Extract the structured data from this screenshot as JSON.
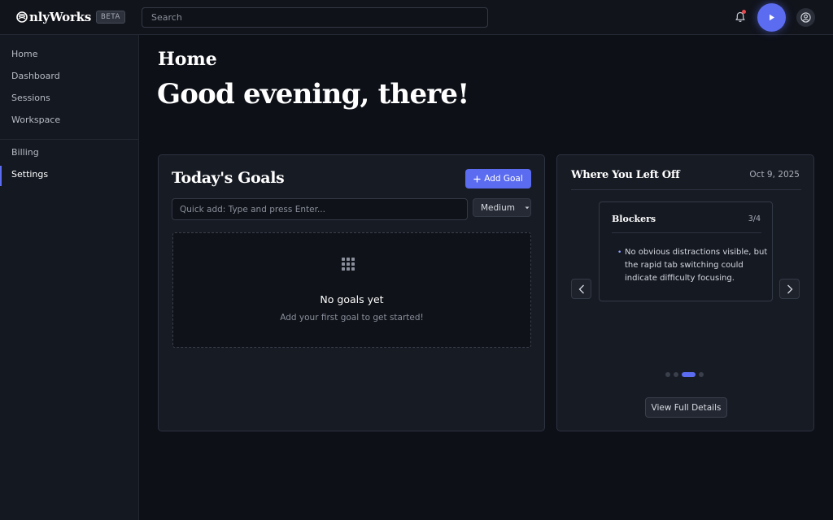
{
  "app": {
    "logo_text": "nlyWorks",
    "beta_badge": "BETA"
  },
  "search": {
    "placeholder": "Search",
    "value": ""
  },
  "header_icons": [
    "bell-icon",
    "play-icon",
    "user-circle-icon"
  ],
  "sidebar": {
    "items": [
      {
        "label": "Home"
      },
      {
        "label": "Dashboard"
      },
      {
        "label": "Sessions"
      },
      {
        "label": "Workspace"
      },
      {
        "label": "Billing"
      },
      {
        "label": "Settings",
        "active": true
      }
    ]
  },
  "main": {
    "page_label": "Home",
    "greeting": "Good evening, there!"
  },
  "goals": {
    "title": "Today's Goals",
    "add_button": "Add Goal",
    "quick_add_placeholder": "Quick add: Type and press Enter...",
    "priority_value": "Medium",
    "empty_title": "No goals yet",
    "empty_subtitle": "Add your first goal to get started!"
  },
  "where_you_left_off": {
    "title": "Where You Left Off",
    "date": "Oct 9, 2025",
    "slide": {
      "title": "Blockers",
      "counter": "3/4",
      "text": "No obvious distractions visible, but the rapid tab switching could indicate difficulty focusing."
    },
    "carousel": {
      "total": 4,
      "active_index": 2
    },
    "view_button": "View Full Details"
  },
  "colors": {
    "accent": "#5b6cf0",
    "background": "#0d1017",
    "card": "#171b24",
    "notification_dot": "#e5484d"
  }
}
